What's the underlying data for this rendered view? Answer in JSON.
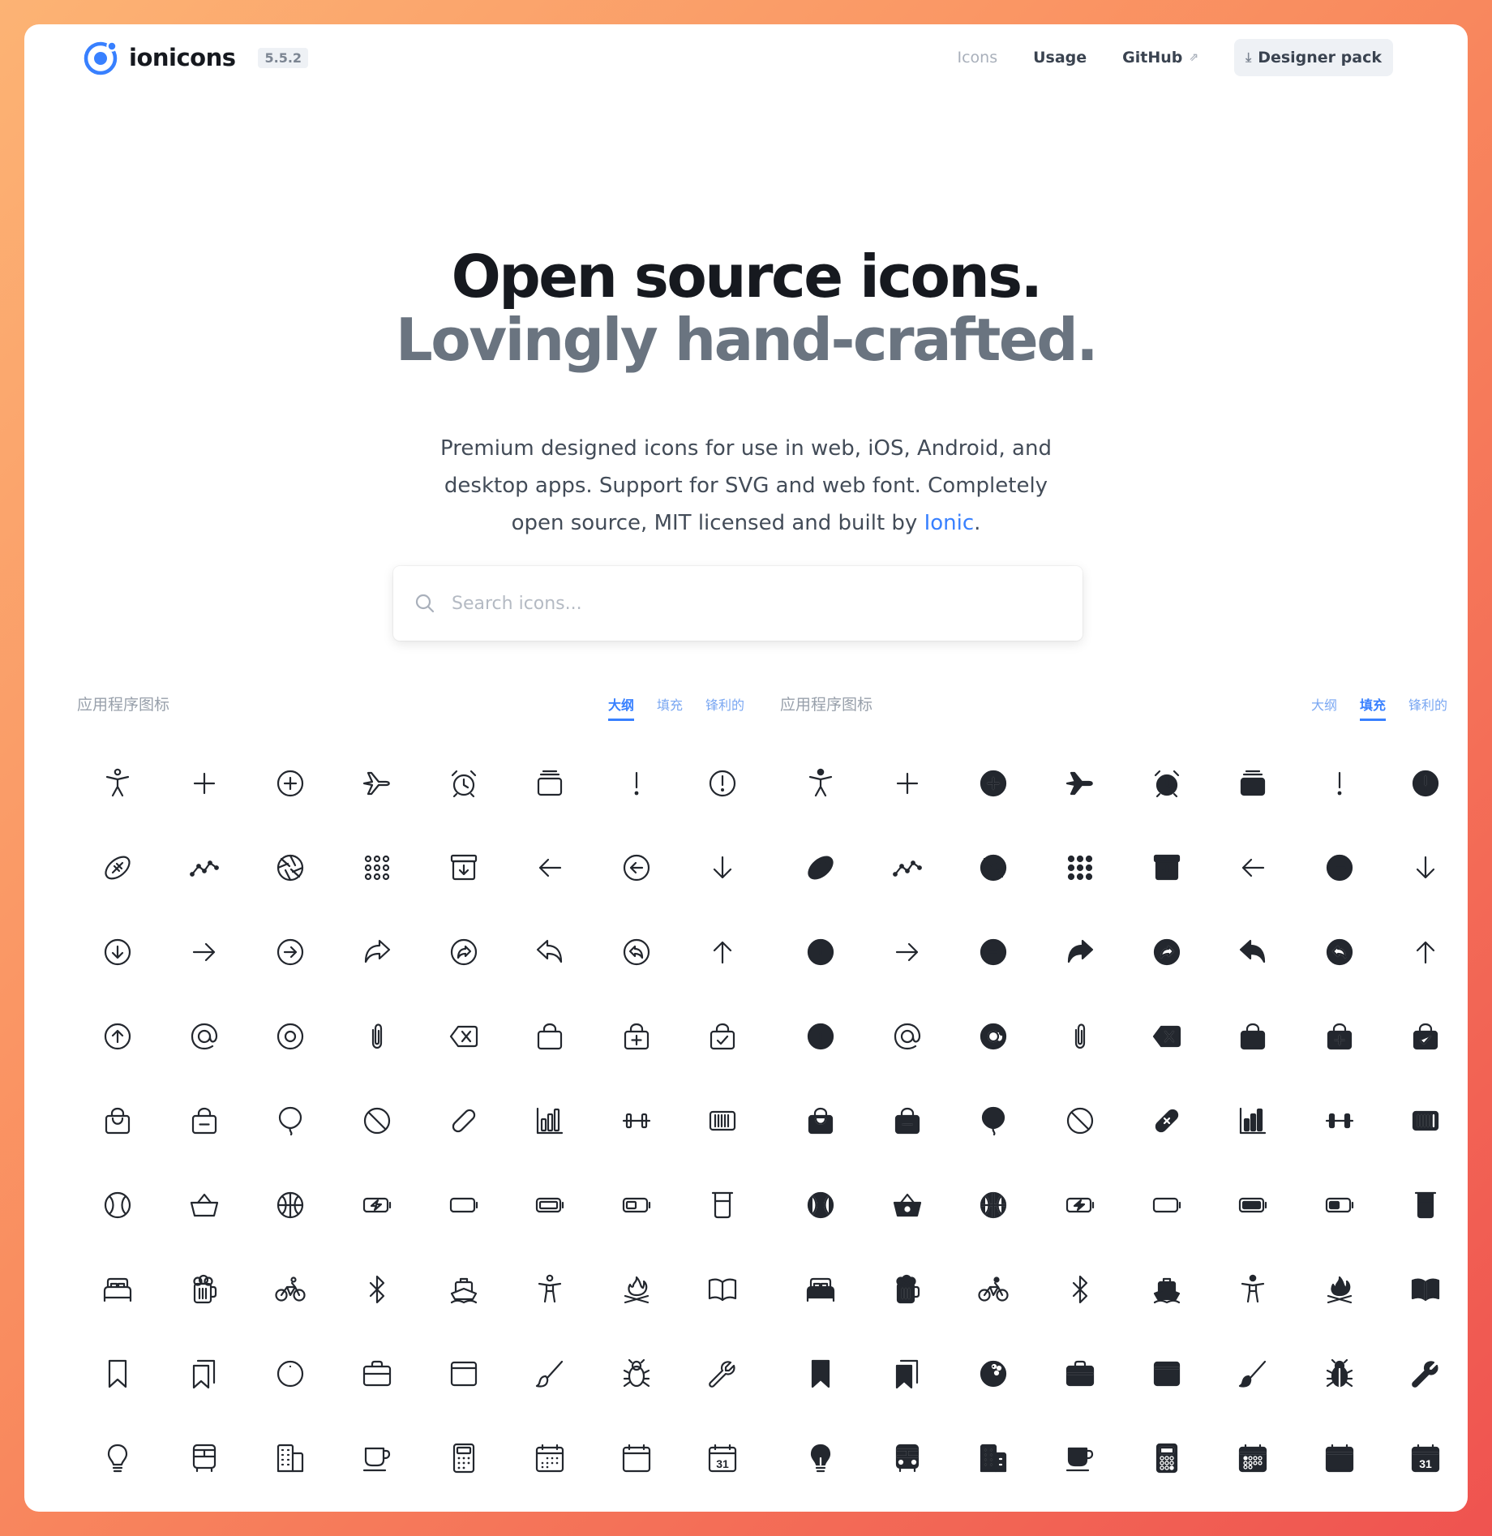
{
  "header": {
    "logo_text": "ionicons",
    "version": "5.5.2",
    "nav": [
      "Icons",
      "Usage",
      "GitHub"
    ],
    "designer_pack": "Designer pack",
    "brand_color": "#3880ff"
  },
  "hero": {
    "line1": "Open source icons.",
    "line2": "Lovingly hand-crafted.",
    "desc_before": "Premium designed icons for use in web, iOS, Android, and desktop apps. Support for SVG and web font. Completely open source, MIT licensed and built by ",
    "desc_link": "Ionic",
    "desc_after": "."
  },
  "search": {
    "placeholder": "Search icons..."
  },
  "panels": {
    "left": {
      "title": "应用程序图标",
      "tabs": [
        "大纲",
        "填充",
        "锋利的"
      ],
      "active_tab": "大纲"
    },
    "right": {
      "title": "应用程序图标",
      "tabs": [
        "大纲",
        "填充",
        "锋利的"
      ],
      "active_tab": "填充"
    }
  },
  "icons": [
    "accessibility",
    "add",
    "add-circle",
    "airplane",
    "alarm",
    "albums",
    "alert",
    "alert-circle",
    "american-football",
    "analytics",
    "aperture",
    "apps",
    "archive",
    "arrow-back",
    "arrow-back-circle",
    "arrow-down",
    "arrow-down-circle",
    "arrow-forward",
    "arrow-forward-circle",
    "arrow-redo",
    "arrow-redo-circle",
    "arrow-undo",
    "arrow-undo-circle",
    "arrow-up",
    "arrow-up-circle",
    "at",
    "at-circle",
    "attach",
    "backspace",
    "bag",
    "bag-add",
    "bag-check",
    "bag-handle",
    "bag-remove",
    "balloon",
    "ban",
    "bandage",
    "bar-chart",
    "barbell",
    "barcode",
    "baseball",
    "basket",
    "basketball",
    "battery-charging",
    "battery-dead",
    "battery-full",
    "battery-half",
    "beaker",
    "bed",
    "beer",
    "bicycle",
    "bluetooth",
    "boat",
    "body",
    "bonfire",
    "book",
    "bookmark",
    "bookmarks",
    "bowling-ball",
    "briefcase",
    "browsers",
    "brush",
    "bug",
    "build",
    "bulb",
    "bus",
    "business",
    "cafe",
    "calculator",
    "calendar",
    "calendar-clear",
    "calendar-number"
  ]
}
